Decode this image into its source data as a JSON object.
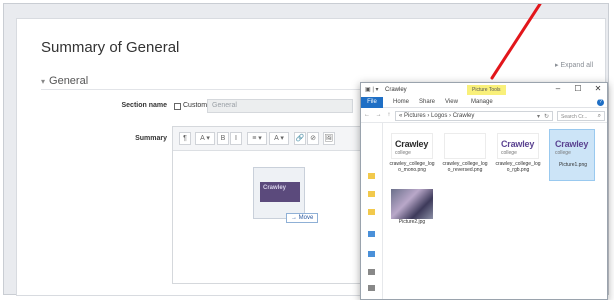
{
  "page": {
    "title": "Summary of General",
    "expand_all": "Expand all",
    "section_heading": "General",
    "section_name_label": "Section name",
    "custom_label": "Custom",
    "section_name_value": "General",
    "summary_label": "Summary"
  },
  "editor": {
    "toolbar_buttons": [
      "¶",
      "A ▾",
      "B",
      "I",
      "≡ ▾",
      "A ▾",
      "🔗",
      "⊘",
      "🖼"
    ],
    "drag_image_text": "Crawley",
    "move_tag": "Move"
  },
  "explorer": {
    "window_title": "Crawley",
    "contextual_tab": "Picture Tools",
    "ribbon_file": "File",
    "ribbon_tabs": [
      "Home",
      "Share",
      "View",
      "Manage"
    ],
    "minimize": "–",
    "maximize": "☐",
    "close": "✕",
    "help": "?",
    "nav_arrows": "← → ↑",
    "address": "« Pictures › Logos › Crawley",
    "search_placeholder": "Search Cr...",
    "files": [
      {
        "name": "crawley_college_logo_mono.png",
        "logo": "Crawley",
        "sub": "college",
        "style": "dark"
      },
      {
        "name": "crawley_college_logo_reversed.png",
        "logo": "",
        "sub": "",
        "style": "blank"
      },
      {
        "name": "crawley_college_logo_rgb.png",
        "logo": "Crawley",
        "sub": "college",
        "style": "purple"
      },
      {
        "name": "Picture1.png",
        "logo": "Crawley",
        "sub": "college",
        "style": "purple-selected"
      },
      {
        "name": "Picture2.jpg",
        "logo": "",
        "sub": "",
        "style": "photo"
      }
    ]
  },
  "colors": {
    "arrow": "#e2161b",
    "file_tab": "#1f6fc5",
    "context_tab": "#f9f07a",
    "brand_purple": "#5b4391"
  }
}
